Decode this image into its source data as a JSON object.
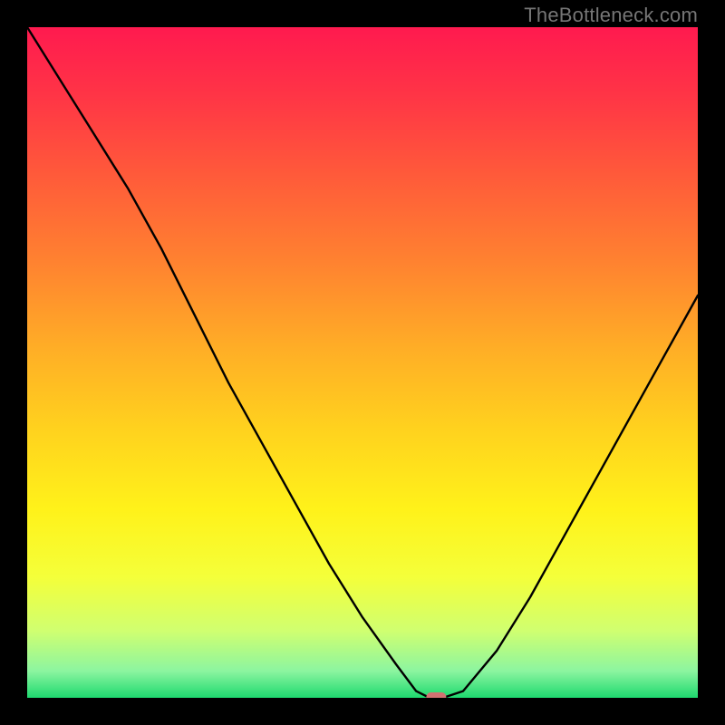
{
  "watermark": "TheBottleneck.com",
  "chart_data": {
    "type": "line",
    "title": "",
    "xlabel": "",
    "ylabel": "",
    "xlim": [
      0,
      100
    ],
    "ylim": [
      0,
      100
    ],
    "grid": false,
    "series": [
      {
        "name": "bottleneck-curve",
        "x": [
          0,
          5,
          10,
          15,
          20,
          25,
          30,
          35,
          40,
          45,
          50,
          55,
          58,
          60,
          62,
          65,
          70,
          75,
          80,
          85,
          90,
          95,
          100
        ],
        "y": [
          100,
          92,
          84,
          76,
          67,
          57,
          47,
          38,
          29,
          20,
          12,
          5,
          1,
          0,
          0,
          1,
          7,
          15,
          24,
          33,
          42,
          51,
          60
        ],
        "color": "#000000"
      }
    ],
    "marker": {
      "name": "optimal-point",
      "x": 61,
      "y": 0,
      "color": "#d17272"
    },
    "gradient_stops": [
      {
        "offset": 0.0,
        "color": "#ff1a4f"
      },
      {
        "offset": 0.1,
        "color": "#ff3446"
      },
      {
        "offset": 0.22,
        "color": "#ff5a3a"
      },
      {
        "offset": 0.35,
        "color": "#ff8230"
      },
      {
        "offset": 0.48,
        "color": "#ffae26"
      },
      {
        "offset": 0.6,
        "color": "#ffd21e"
      },
      {
        "offset": 0.72,
        "color": "#fff21a"
      },
      {
        "offset": 0.82,
        "color": "#f4ff3a"
      },
      {
        "offset": 0.9,
        "color": "#d0ff70"
      },
      {
        "offset": 0.96,
        "color": "#8cf5a0"
      },
      {
        "offset": 1.0,
        "color": "#1ed96f"
      }
    ]
  }
}
